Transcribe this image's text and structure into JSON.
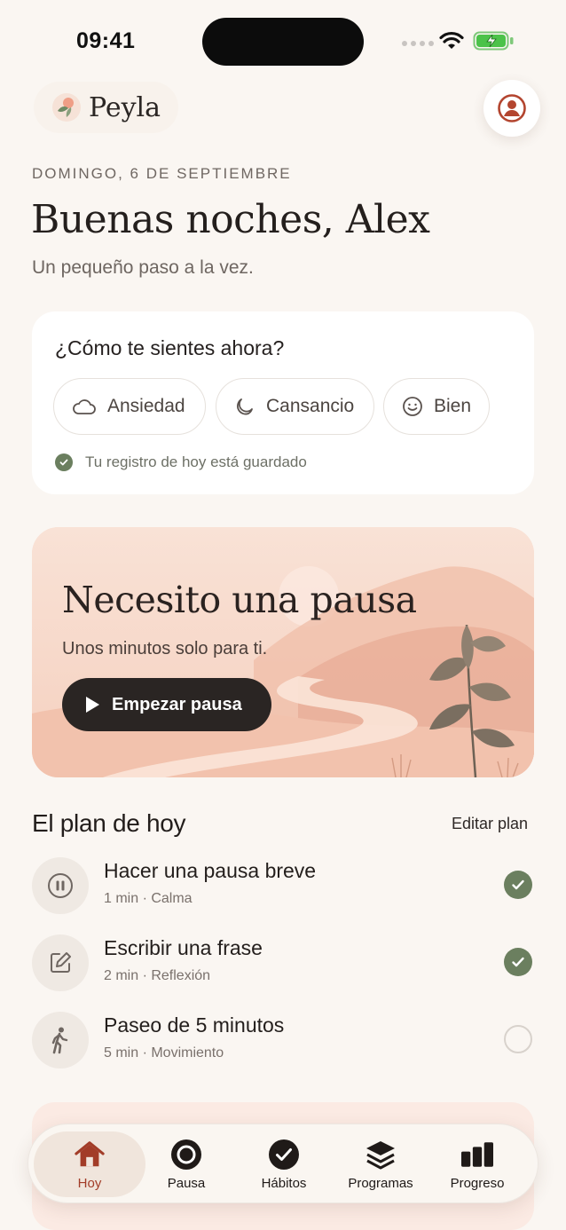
{
  "status_bar": {
    "time": "09:41"
  },
  "header": {
    "app_name": "Peyla"
  },
  "greeting": {
    "date": "DOMINGO, 6 DE SEPTIEMBRE",
    "title": "Buenas noches, Alex",
    "subtitle": "Un pequeño paso a la vez."
  },
  "mood": {
    "question": "¿Cómo te sientes ahora?",
    "options": [
      {
        "label": "Ansiedad",
        "icon": "cloud-icon"
      },
      {
        "label": "Cansancio",
        "icon": "moon-icon"
      },
      {
        "label": "Bien",
        "icon": "smile-icon"
      }
    ],
    "saved_text": "Tu registro de hoy está guardado"
  },
  "pause_card": {
    "title": "Necesito una pausa",
    "subtitle": "Unos minutos solo para ti.",
    "button_label": "Empezar pausa"
  },
  "plan": {
    "title": "El plan de hoy",
    "edit_label": "Editar plan",
    "items": [
      {
        "name": "Hacer una pausa breve",
        "meta": "1 min · Calma",
        "icon": "pause-circle-icon",
        "done": true
      },
      {
        "name": "Escribir una frase",
        "meta": "2 min · Reflexión",
        "icon": "edit-icon",
        "done": true
      },
      {
        "name": "Paseo de 5 minutos",
        "meta": "5 min · Movimiento",
        "icon": "walk-icon",
        "done": false
      }
    ]
  },
  "tabs": [
    {
      "label": "Hoy",
      "icon": "home-icon",
      "active": true
    },
    {
      "label": "Pausa",
      "icon": "pause-tab-icon",
      "active": false
    },
    {
      "label": "Hábitos",
      "icon": "check-circle-icon",
      "active": false
    },
    {
      "label": "Programas",
      "icon": "layers-icon",
      "active": false
    },
    {
      "label": "Progreso",
      "icon": "bar-chart-icon",
      "active": false
    }
  ],
  "colors": {
    "background": "#faf6f2",
    "accent": "#a23c28",
    "sage": "#6b7f5f",
    "dark_button": "#2a2523"
  }
}
